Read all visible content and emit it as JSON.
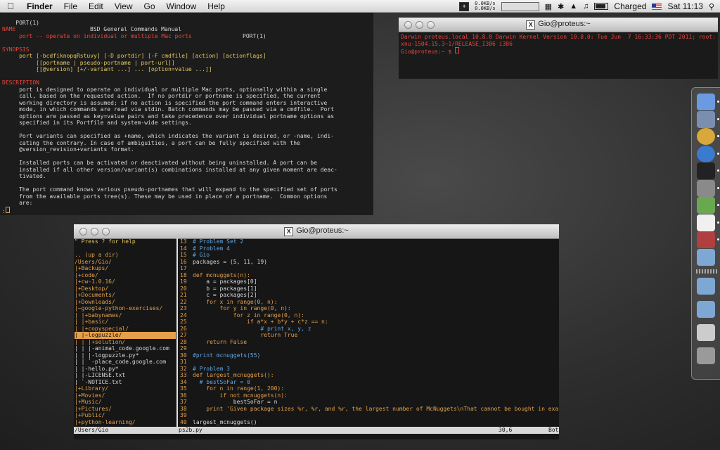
{
  "menubar": {
    "app": "Finder",
    "menus": [
      "File",
      "Edit",
      "View",
      "Go",
      "Window",
      "Help"
    ],
    "net_up": "0.0KB/s",
    "net_down": "0.0KB/s",
    "battery_status": "Charged",
    "clock": "Sat 11:13"
  },
  "man": {
    "header_left": "PORT(1)",
    "header_center": "BSD General Commands Manual",
    "header_right": "PORT(1)",
    "name_heading": "NAME",
    "name_line": "     port -- operate on individual or multiple Mac ports",
    "synopsis_heading": "SYNOPSIS",
    "synopsis": [
      "     port [-bcdfiknopqRstuvy] [-D portdir] [-F cmdfile] [action] [actionflags]",
      "          [[portname | pseudo-portname | port-url]]",
      "          [[@version] [+/-variant ...] ... [option=value ...]]"
    ],
    "description_heading": "DESCRIPTION",
    "description": [
      "     port is designed to operate on individual or multiple Mac ports, optionally within a single",
      "     call, based on the requested action.  If no portdir or portname is specified, the current",
      "     working directory is assumed; if no action is specified the port command enters interactive",
      "     mode, in which commands are read via stdin. Batch commands may be passed via a cmdfile.  Port",
      "     options are passed as key=value pairs and take precedence over individual portname options as",
      "     specified in its Portfile and system-wide settings.",
      "",
      "     Port variants can specified as +name, which indicates the variant is desired, or -name, indi-",
      "     cating the contrary. In case of ambiguities, a port can be fully specified with the",
      "     @version_revision+variants format.",
      "",
      "     Installed ports can be activated or deactivated without being uninstalled. A port can be",
      "     installed if all other version/variant(s) combinations installed at any given moment are deac-",
      "     tivated.",
      "",
      "     The port command knows various pseudo-portnames that will expand to the specified set of ports",
      "     from the available ports tree(s). These may be used in place of a portname.  Common options",
      "     are:"
    ],
    "prompt": ":"
  },
  "smallterm": {
    "title": "Gio@proteus:~",
    "lines": [
      "Darwin proteus.local 10.8.0 Darwin Kernel Version 10.8.0: Tue Jun  7 16:33:36 PDT 2011; root:",
      "xnu-1504.15.3~1/RELEASE_I386 i386",
      "Gio@proteus:~ $ "
    ]
  },
  "vim": {
    "title": "Gio@proteus:~",
    "tree_header": "\" Press ? for help",
    "tree": [
      "",
      ".. (up a dir)",
      "/Users/Gio/",
      "|+Backups/",
      "|+code/",
      "|+cw-1.0.16/",
      "|+Desktop/",
      "|+Documents/",
      "|+Downloads/",
      "|~google-python-exercises/",
      "| |+babynames/",
      "| |+basic/",
      "| |+copyspecial/",
      "| |~logpuzzle/",
      "| | |+solution/",
      "| | |-animal_code.google.com",
      "| | |-logpuzzle.py*",
      "| | `-place_code.google.com",
      "| |-hello.py*",
      "| |-LICENSE.txt",
      "| `-NOTICE.txt",
      "|+Library/",
      "|+Movies/",
      "|+Music/",
      "|+Pictures/",
      "|+Public/",
      "|+python-learning/"
    ],
    "code": [
      {
        "n": "13",
        "t": "# Problem Set 2"
      },
      {
        "n": "14",
        "t": "# Problem 4"
      },
      {
        "n": "15",
        "t": "# Gio"
      },
      {
        "n": "16",
        "t": "packages = (5, 11, 19)"
      },
      {
        "n": "17",
        "t": ""
      },
      {
        "n": "18",
        "t": "def mcnuggets(n):"
      },
      {
        "n": "19",
        "t": "    a = packages[0]"
      },
      {
        "n": "20",
        "t": "    b = packages[1]"
      },
      {
        "n": "21",
        "t": "    c = packages[2]"
      },
      {
        "n": "22",
        "t": "    for x in range(0, n):"
      },
      {
        "n": "23",
        "t": "        for y in range(0, n):"
      },
      {
        "n": "24",
        "t": "            for z in range(0, n):"
      },
      {
        "n": "25",
        "t": "                if a*x + b*y + c*z == n:"
      },
      {
        "n": "26",
        "t": "                    # print x, y, z"
      },
      {
        "n": "27",
        "t": "                    return True"
      },
      {
        "n": "28",
        "t": "    return False"
      },
      {
        "n": "29",
        "t": ""
      },
      {
        "n": "30",
        "t": "#print mcnuggets(55)"
      },
      {
        "n": "31",
        "t": ""
      },
      {
        "n": "32",
        "t": "# Problem 3"
      },
      {
        "n": "33",
        "t": "def largest_mcnuggets():"
      },
      {
        "n": "34",
        "t": "  # bestSoFar = 0"
      },
      {
        "n": "35",
        "t": "    for n in range(1, 200):"
      },
      {
        "n": "36",
        "t": "        if not mcnuggets(n):"
      },
      {
        "n": "37",
        "t": "            bestSoFar = n"
      },
      {
        "n": "38",
        "t": "    print 'Given package sizes %r, %r, and %r, the largest number of McNuggets\\nThat cannot be bought in exac"
      },
      {
        "n": "39",
        "t": ""
      },
      {
        "n": "40",
        "t": "largest_mcnuggets()"
      }
    ],
    "status_left": "/Users/Gio",
    "status_file": "ps2b.py",
    "status_pos": "30,6",
    "status_pct": "Bot"
  },
  "dock": {
    "icons": [
      "finder-icon",
      "preview-icon",
      "chrome-icon",
      "itunes-icon",
      "terminal-icon",
      "system-preferences-icon",
      "textmate-icon",
      "x11-icon",
      "photo-icon",
      "applications-folder-icon",
      "documents-folder-icon",
      "downloads-folder-icon",
      "stack-icon",
      "trash-icon"
    ],
    "colors": {
      "finder": "#5b8fd6",
      "chrome": "#d9a83a",
      "itunes": "#3a7bd0",
      "terminal": "#222222",
      "folder": "#7fa7d4"
    }
  }
}
